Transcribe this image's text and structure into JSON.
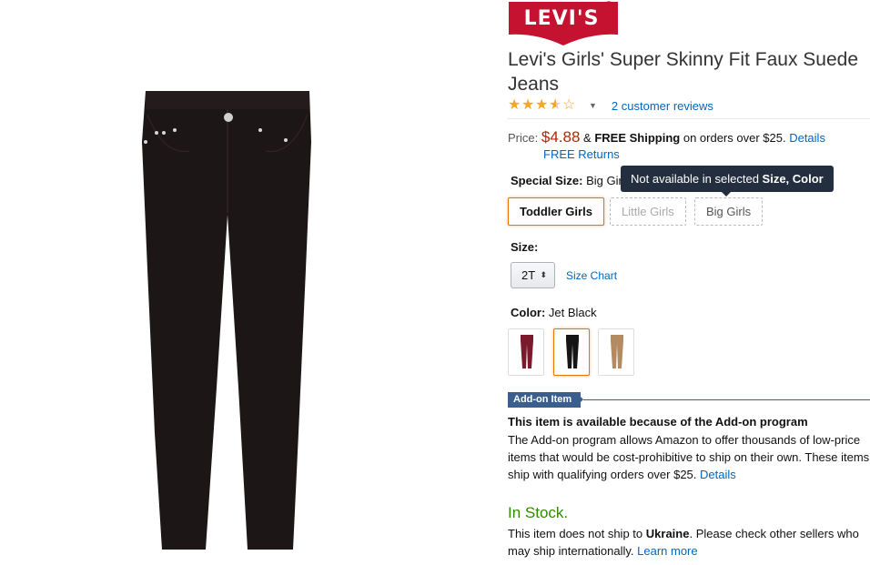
{
  "brand": {
    "logo_text": "LEVI'S",
    "registered_mark": "R",
    "logo_color": "#c41230"
  },
  "product": {
    "title": "Levi's Girls' Super Skinny Fit Faux Suede Jeans",
    "image_icon": "black-skinny-jeans-image"
  },
  "rating": {
    "stars": 3.5,
    "max_stars": 5,
    "reviews_link": "2 customer reviews"
  },
  "price": {
    "label": "Price:",
    "value": "$4.88",
    "ampersand": "&",
    "free_shipping": "FREE Shipping",
    "shipping_suffix": "on orders over $25.",
    "details_link": "Details",
    "free_returns_link": "FREE Returns"
  },
  "special_size": {
    "label": "Special Size:",
    "selected": "Big Girls",
    "options": [
      "Toddler Girls",
      "Little Girls",
      "Big Girls"
    ]
  },
  "tooltip": {
    "prefix": "Not available in selected",
    "bold": "Size, Color"
  },
  "size": {
    "label": "Size:",
    "selected": "2T",
    "size_chart_link": "Size Chart"
  },
  "color": {
    "label": "Color:",
    "selected": "Jet Black",
    "swatches": [
      {
        "name": "burgundy",
        "hex": "#7a1a2c"
      },
      {
        "name": "jet-black",
        "hex": "#151515"
      },
      {
        "name": "tan",
        "hex": "#b48a62"
      }
    ]
  },
  "addon": {
    "badge": "Add-on Item",
    "heading": "This item is available because of the Add-on program",
    "text": "The Add-on program allows Amazon to offer thousands of low-price items that would be cost-prohibitive to ship on their own. These items ship with qualifying orders over $25.",
    "details_link": "Details"
  },
  "stock": {
    "status": "In Stock.",
    "ship_prefix": "This item does not ship to",
    "country": "Ukraine",
    "ship_suffix": ". Please check other sellers who may ship internationally.",
    "learn_more_link": "Learn more"
  }
}
